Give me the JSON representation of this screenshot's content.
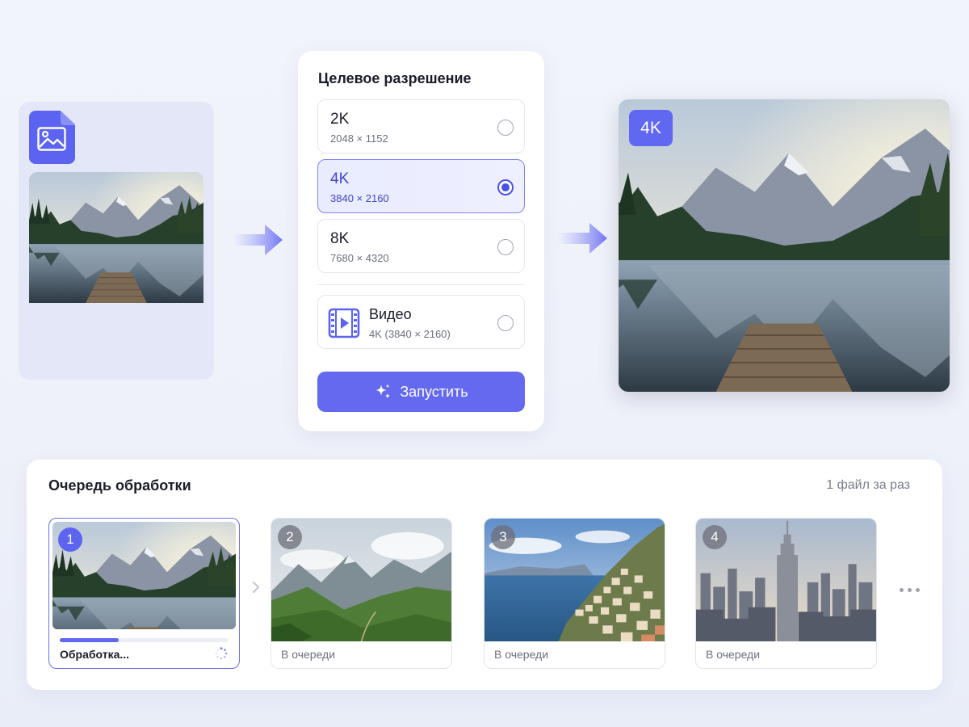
{
  "settings": {
    "title": "Целевое разрешение",
    "options": [
      {
        "label": "2K",
        "sub": "2048 × 1152",
        "selected": false
      },
      {
        "label": "4K",
        "sub": "3840 × 2160",
        "selected": true
      },
      {
        "label": "8K",
        "sub": "7680 × 4320",
        "selected": false
      }
    ],
    "video": {
      "label": "Видео",
      "sub": "4K (3840 × 2160)",
      "selected": false
    },
    "run_label": "Запустить"
  },
  "result": {
    "badge": "4K"
  },
  "queue": {
    "title": "Очередь обработки",
    "count_text": "1 файл за раз",
    "items": [
      {
        "num": "1",
        "status": "Обработка...",
        "progress": 0.35,
        "active": true
      },
      {
        "num": "2",
        "status": "В очереди"
      },
      {
        "num": "3",
        "status": "В очереди"
      },
      {
        "num": "4",
        "status": "В очереди"
      }
    ]
  },
  "colors": {
    "accent": "#6469f0",
    "accent_dark": "#4a52e6",
    "selected_bg": "#e9ebff"
  },
  "icons": [
    "image-file-icon",
    "arrow-right-icon",
    "video-film-icon",
    "sparkle-icon",
    "chevron-right-icon",
    "spinner-icon",
    "more-dots-icon"
  ]
}
